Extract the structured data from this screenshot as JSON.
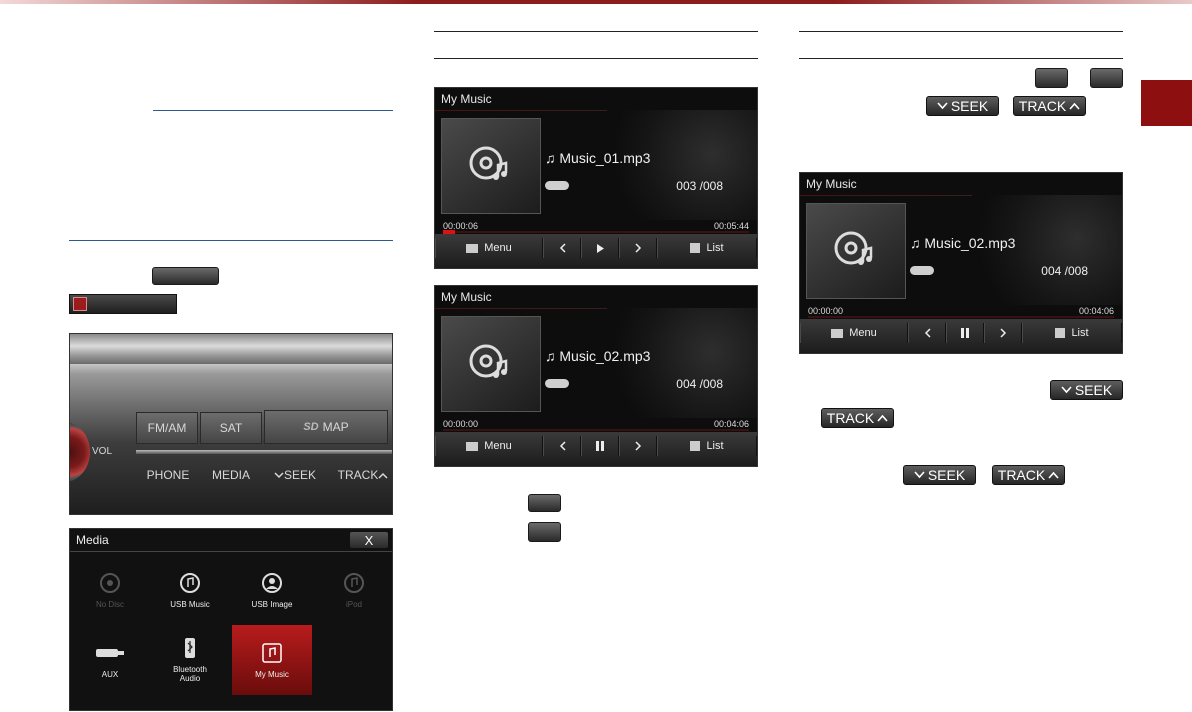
{
  "header": {
    "accent_color": "#8d1c1c",
    "side_tab_color": "#8e0f0f"
  },
  "left_column": {
    "button_1_icon": "blank-dark-button",
    "media_bar_icon": "music-note-icon"
  },
  "radio_panel": {
    "buttons": [
      {
        "label": "FM/AM"
      },
      {
        "label": "SAT"
      },
      {
        "label": "MAP",
        "prefix": "SD"
      },
      {
        "label": "VOL"
      },
      {
        "label": "PHONE"
      },
      {
        "label": "MEDIA"
      },
      {
        "label": "SEEK"
      },
      {
        "label": "TRACK"
      }
    ]
  },
  "media_menu": {
    "title": "Media",
    "close_label": "X",
    "items": [
      {
        "label": "No Disc",
        "icon": "disc-icon",
        "enabled": false
      },
      {
        "label": "USB Music",
        "icon": "usb-music-icon",
        "enabled": true
      },
      {
        "label": "USB Image",
        "icon": "usb-image-icon",
        "enabled": true
      },
      {
        "label": "iPod",
        "icon": "ipod-icon",
        "enabled": false
      },
      {
        "label": "AUX",
        "icon": "aux-icon",
        "enabled": true
      },
      {
        "label": "Bluetooth Audio",
        "icon": "bluetooth-audio-icon",
        "enabled": true
      },
      {
        "label": "My Music",
        "icon": "my-music-icon",
        "enabled": true,
        "selected": true
      }
    ]
  },
  "screens": [
    {
      "title": "My Music",
      "song": "♫ Music_01.mp3",
      "count": "003 /008",
      "elapsed": "00:00:06",
      "total": "00:05:44",
      "state": "paused-shows-play",
      "progress": 0.02,
      "menu_label": "Menu",
      "list_label": "List"
    },
    {
      "title": "My Music",
      "song": "♫ Music_02.mp3",
      "count": "004 /008",
      "elapsed": "00:00:00",
      "total": "00:04:06",
      "state": "playing-shows-pause",
      "progress": 0,
      "menu_label": "Menu",
      "list_label": "List"
    },
    {
      "title": "My Music",
      "song": "♫ Music_02.mp3",
      "count": "004 /008",
      "elapsed": "00:00:00",
      "total": "00:04:06",
      "state": "playing-shows-pause",
      "progress": 0,
      "menu_label": "Menu",
      "list_label": "List"
    }
  ],
  "hard_keys": {
    "seek": "SEEK",
    "track": "TRACK"
  }
}
